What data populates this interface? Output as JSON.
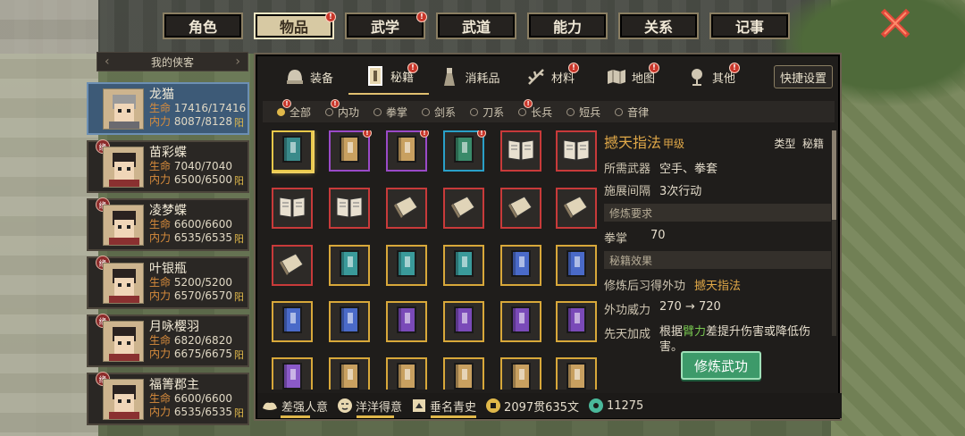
{
  "top_tabs": [
    {
      "label": "角色",
      "active": false,
      "badge": false
    },
    {
      "label": "物品",
      "active": true,
      "badge": true
    },
    {
      "label": "武学",
      "active": false,
      "badge": true
    },
    {
      "label": "武道",
      "active": false,
      "badge": false
    },
    {
      "label": "能力",
      "active": false,
      "badge": false
    },
    {
      "label": "关系",
      "active": false,
      "badge": false
    },
    {
      "label": "记事",
      "active": false,
      "badge": false
    }
  ],
  "party": {
    "header": "我的侠客",
    "members": [
      {
        "name": "龙猫",
        "hp": "17416/17416",
        "mp": "8087/8128",
        "affinity": "阳",
        "active": true,
        "yuan": false
      },
      {
        "name": "苗彩蝶",
        "hp": "7040/7040",
        "mp": "6500/6500",
        "affinity": "阳",
        "active": false,
        "yuan": true
      },
      {
        "name": "凌梦蝶",
        "hp": "6600/6600",
        "mp": "6535/6535",
        "affinity": "阳",
        "active": false,
        "yuan": true
      },
      {
        "name": "叶银瓶",
        "hp": "5200/5200",
        "mp": "6570/6570",
        "affinity": "阳",
        "active": false,
        "yuan": true
      },
      {
        "name": "月咏樱羽",
        "hp": "6820/6820",
        "mp": "6675/6675",
        "affinity": "阳",
        "active": false,
        "yuan": true
      },
      {
        "name": "福箐郡主",
        "hp": "6600/6600",
        "mp": "6535/6535",
        "affinity": "阳",
        "active": false,
        "yuan": true
      }
    ],
    "hp_label": "生命",
    "mp_label": "内力",
    "yuan_char": "缘"
  },
  "sub_tabs": [
    {
      "label": "装备",
      "icon": "helmet-icon",
      "active": false,
      "badge": false
    },
    {
      "label": "秘籍",
      "icon": "scroll-icon",
      "active": true,
      "badge": true
    },
    {
      "label": "消耗品",
      "icon": "potion-icon",
      "active": false,
      "badge": false
    },
    {
      "label": "材料",
      "icon": "herb-icon",
      "active": false,
      "badge": true
    },
    {
      "label": "地图",
      "icon": "map-icon",
      "active": false,
      "badge": true
    },
    {
      "label": "其他",
      "icon": "misc-icon",
      "active": false,
      "badge": true
    }
  ],
  "quick_settings": "快捷设置",
  "filters": [
    {
      "label": "全部",
      "active": true,
      "badge": true
    },
    {
      "label": "内功",
      "active": false,
      "badge": true
    },
    {
      "label": "拳掌",
      "active": false,
      "badge": false
    },
    {
      "label": "剑系",
      "active": false,
      "badge": false
    },
    {
      "label": "刀系",
      "active": false,
      "badge": false
    },
    {
      "label": "长兵",
      "active": false,
      "badge": true
    },
    {
      "label": "短兵",
      "active": false,
      "badge": false
    },
    {
      "label": "音律",
      "active": false,
      "badge": false
    }
  ],
  "items": [
    {
      "border": "#e8c84a",
      "book": "#3a8a8a",
      "style": "closed",
      "badge": false,
      "selected": true
    },
    {
      "border": "#9a4ac8",
      "book": "#c8a060",
      "style": "closed",
      "badge": true
    },
    {
      "border": "#9a4ac8",
      "book": "#c8a060",
      "style": "closed",
      "badge": true
    },
    {
      "border": "#2aa0c8",
      "book": "#3a8a6a",
      "style": "closed",
      "badge": true
    },
    {
      "border": "#c83a3a",
      "book": "#e8e0d0",
      "style": "open",
      "badge": false
    },
    {
      "border": "#c83a3a",
      "book": "#e8e0d0",
      "style": "open",
      "badge": false
    },
    {
      "border": "#c83a3a",
      "book": "#e8e0d0",
      "style": "open",
      "badge": false
    },
    {
      "border": "#c83a3a",
      "book": "#e8e0d0",
      "style": "open",
      "badge": false
    },
    {
      "border": "#c83a3a",
      "book": "#e0d4b8",
      "style": "tilt",
      "badge": false
    },
    {
      "border": "#c83a3a",
      "book": "#e0d4b8",
      "style": "tilt",
      "badge": false
    },
    {
      "border": "#c83a3a",
      "book": "#e0d4b8",
      "style": "tilt",
      "badge": false
    },
    {
      "border": "#c83a3a",
      "book": "#e0d4b8",
      "style": "tilt",
      "badge": false
    },
    {
      "border": "#c83a3a",
      "book": "#e0d4b8",
      "style": "tilt",
      "badge": false
    },
    {
      "border": "#d8a83a",
      "book": "#3a9a9a",
      "style": "closed",
      "badge": false
    },
    {
      "border": "#d8a83a",
      "book": "#3a9a9a",
      "style": "closed",
      "badge": false
    },
    {
      "border": "#d8a83a",
      "book": "#3a9a9a",
      "style": "closed",
      "badge": false
    },
    {
      "border": "#d8a83a",
      "book": "#4a6ac8",
      "style": "closed",
      "badge": false
    },
    {
      "border": "#d8a83a",
      "book": "#4a6ac8",
      "style": "closed",
      "badge": false
    },
    {
      "border": "#d8a83a",
      "book": "#4a6ac8",
      "style": "closed",
      "badge": false
    },
    {
      "border": "#d8a83a",
      "book": "#4a6ac8",
      "style": "closed",
      "badge": false
    },
    {
      "border": "#d8a83a",
      "book": "#7a4ab8",
      "style": "closed",
      "badge": false
    },
    {
      "border": "#d8a83a",
      "book": "#7a4ab8",
      "style": "closed",
      "badge": false
    },
    {
      "border": "#d8a83a",
      "book": "#7a4ab8",
      "style": "closed",
      "badge": false
    },
    {
      "border": "#d8a83a",
      "book": "#7a4ab8",
      "style": "closed",
      "badge": false
    },
    {
      "border": "#d8a83a",
      "book": "#8a5ac8",
      "style": "closed",
      "badge": false
    },
    {
      "border": "#d8a83a",
      "book": "#c8a060",
      "style": "closed",
      "badge": false
    },
    {
      "border": "#d8a83a",
      "book": "#c8a060",
      "style": "closed",
      "badge": false
    },
    {
      "border": "#d8a83a",
      "book": "#c8a060",
      "style": "closed",
      "badge": false
    },
    {
      "border": "#d8a83a",
      "book": "#c8a060",
      "style": "closed",
      "badge": false
    },
    {
      "border": "#d8a83a",
      "book": "#c8a060",
      "style": "closed",
      "badge": false
    }
  ],
  "detail": {
    "name": "撼天指法",
    "grade": "甲级",
    "type_label": "类型",
    "type_value": "秘籍",
    "weapon_label": "所需武器",
    "weapon_value": "空手、拳套",
    "interval_label": "施展间隔",
    "interval_value": "3次行动",
    "req_section": "修炼要求",
    "req_label": "拳掌",
    "req_value": "70",
    "effect_section": "秘籍效果",
    "learn_label": "修炼后习得外功",
    "learn_value": "撼天指法",
    "power_label": "外功威力",
    "power_value": "270 → 720",
    "bonus_label": "先天加成",
    "bonus_pre": "根据",
    "bonus_attr": "臂力",
    "bonus_post": "差提升伤害或降低伤害。"
  },
  "train_button": "修炼武功",
  "status": {
    "strength": "差强人意",
    "mood": "洋洋得意",
    "fame": "垂名青史",
    "money": "2097贯635文",
    "jade": "11275",
    "strength_progress": 0.55,
    "mood_progress": 0.7,
    "fame_progress": 0.85
  }
}
